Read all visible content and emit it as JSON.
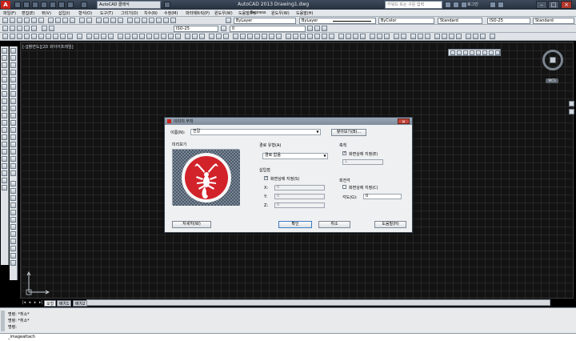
{
  "titlebar": {
    "workspace": "AutoCAD 클래식",
    "title": "AutoCAD 2013    Drawing1.dwg",
    "search_placeholder": "키워드 또는 구문 입력",
    "login": "로그인"
  },
  "menu": [
    "파일(F)",
    "편집(E)",
    "뷰(V)",
    "삽입(I)",
    "형식(O)",
    "도구(T)",
    "그리기(D)",
    "치수(N)",
    "수정(M)",
    "파라메트릭(P)",
    "윈도우(W)",
    "도움말(H)",
    "Express",
    "윈도우(W)",
    "도움말(H)"
  ],
  "toolbar": {
    "layer_combo": "ByLayer",
    "linetype_combo": "ByLayer",
    "lineweight_combo": "ByLayer",
    "color_combo": "ByColor",
    "text_style": "Standard",
    "dim_style": "ISO-25",
    "table_style": "Standard",
    "dim_style_2": "ISO-25",
    "layer_name": "0"
  },
  "drawing": {
    "viewport_label": "[-][평면도][2D 와이어프레임]",
    "wcs": "WCS"
  },
  "layout_tabs": [
    "모형",
    "배치1",
    "배치2"
  ],
  "command_history": [
    "명령: *취소*",
    "명령: *취소*",
    "명령:"
  ],
  "command_input": "_imageattach",
  "dialog": {
    "title": "이미지 부착",
    "name_label": "이름(N):",
    "name_value": "전갈",
    "browse_button": "찾아보기(B)...",
    "preview_label": "미리보기",
    "path_type_label": "경로 유형(A)",
    "path_type_value": "경로 없음",
    "insert_point_label": "삽입점",
    "insert_on_screen": "화면상에 지정(S)",
    "x_label": "X:",
    "x_value": "0",
    "y_label": "Y:",
    "y_value": "0",
    "z_label": "Z:",
    "z_value": "0",
    "scale_label": "축척",
    "scale_on_screen": "화면상에 지정(E)",
    "scale_value": "1",
    "rotation_label": "회전각",
    "rotation_on_screen": "화면상에 지정(C)",
    "angle_label": "각도(G):",
    "angle_value": "0",
    "details_button": "자세히(W)",
    "ok_button": "확인",
    "cancel_button": "취소",
    "help_button": "도움말(H)"
  },
  "colors": {
    "accent_red": "#d2232a",
    "ok_border": "#3d7bc4"
  }
}
